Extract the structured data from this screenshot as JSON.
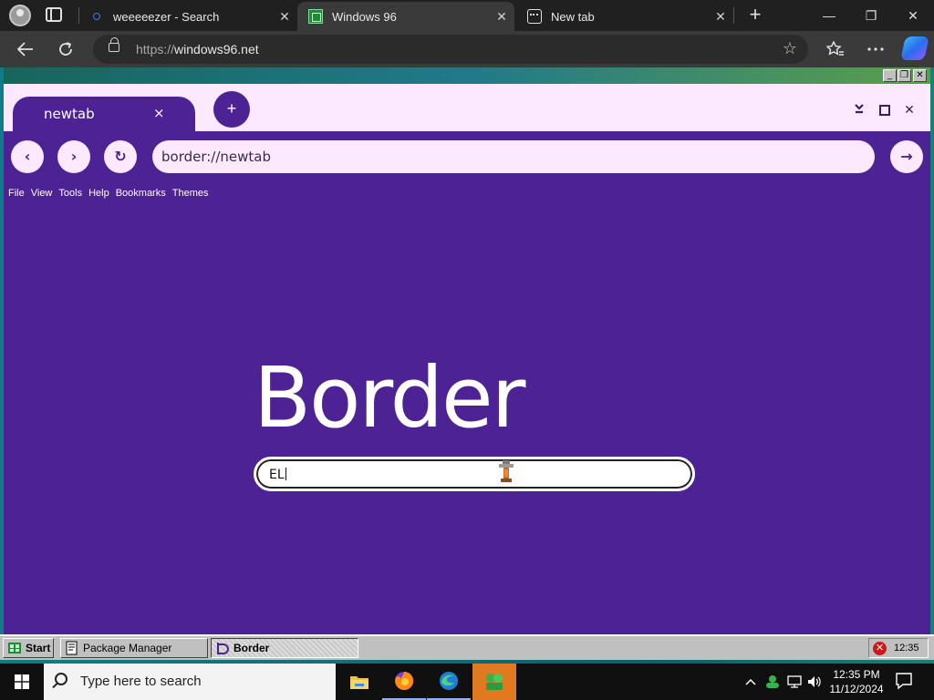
{
  "edge": {
    "tabs": [
      {
        "title": "weeeeezer - Search",
        "icon": "search-icon"
      },
      {
        "title": "Windows 96",
        "icon": "windows96-icon"
      },
      {
        "title": "New tab",
        "icon": "newtab-icon"
      }
    ],
    "close_glyph": "✕",
    "new_tab_glyph": "+",
    "window_controls": {
      "minimize": "—",
      "restore": "❐",
      "close": "✕"
    },
    "address": {
      "protocol": "https://",
      "host": "windows96.net"
    },
    "toolbar_icons": [
      "back-icon",
      "refresh-icon",
      "favorites-star-icon",
      "collections-icon",
      "more-icon",
      "copilot-icon"
    ]
  },
  "border": {
    "tab_label": "newtab",
    "tab_close": "×",
    "add_tab": "+",
    "url": "border://newtab",
    "menu": [
      "File",
      "View",
      "Tools",
      "Help",
      "Bookmarks",
      "Themes"
    ],
    "logo_text": "Border",
    "search_value": "EL",
    "nav_glyphs": {
      "back": "‹",
      "forward": "›",
      "reload": "↻",
      "go": "→"
    }
  },
  "w96_taskbar": {
    "start_label": "Start",
    "items": [
      {
        "label": "Package Manager",
        "active": false
      },
      {
        "label": "Border",
        "active": true
      }
    ],
    "clock": "12:35",
    "error_glyph": "✕"
  },
  "win10_taskbar": {
    "search_placeholder": "Type here to search",
    "apps": [
      "file-explorer-icon",
      "firefox-icon",
      "edge-icon",
      "windows96-app-icon"
    ],
    "time": "12:35 PM",
    "date": "11/12/2024"
  },
  "colors": {
    "border_purple": "#4d2294",
    "border_pink": "#fde9ff",
    "w96_gray": "#c0c0c0",
    "win10_taskbar_active": "#e07a20"
  }
}
